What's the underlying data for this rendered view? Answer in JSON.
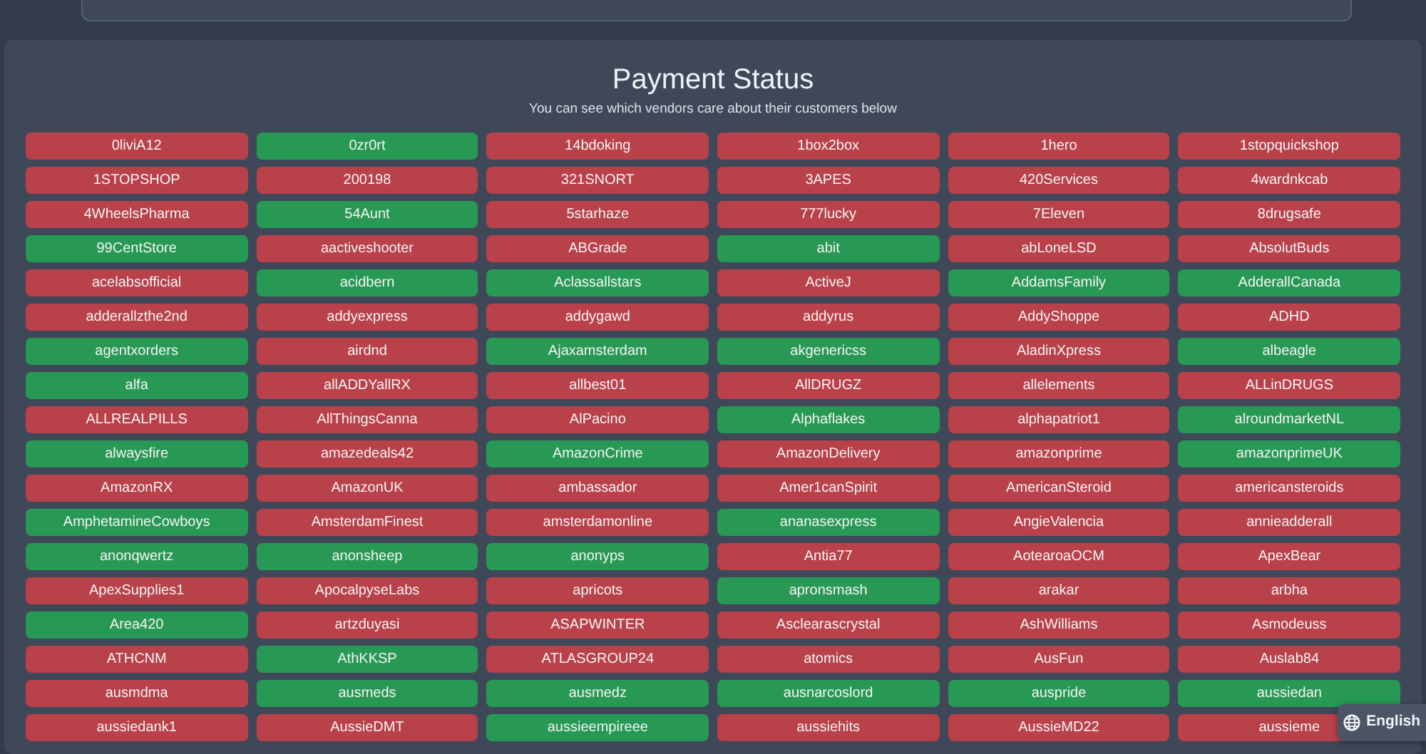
{
  "title": "Payment Status",
  "subtitle": "You can see which vendors care about their customers below",
  "vendors": [
    {
      "name": "0liviA12",
      "ok": false
    },
    {
      "name": "0zr0rt",
      "ok": true
    },
    {
      "name": "14bdoking",
      "ok": false
    },
    {
      "name": "1box2box",
      "ok": false
    },
    {
      "name": "1hero",
      "ok": false
    },
    {
      "name": "1stopquickshop",
      "ok": false
    },
    {
      "name": "1STOPSHOP",
      "ok": false
    },
    {
      "name": "200198",
      "ok": false
    },
    {
      "name": "321SNORT",
      "ok": false
    },
    {
      "name": "3APES",
      "ok": false
    },
    {
      "name": "420Services",
      "ok": false
    },
    {
      "name": "4wardnkcab",
      "ok": false
    },
    {
      "name": "4WheelsPharma",
      "ok": false
    },
    {
      "name": "54Aunt",
      "ok": true
    },
    {
      "name": "5starhaze",
      "ok": false
    },
    {
      "name": "777lucky",
      "ok": false
    },
    {
      "name": "7Eleven",
      "ok": false
    },
    {
      "name": "8drugsafe",
      "ok": false
    },
    {
      "name": "99CentStore",
      "ok": true
    },
    {
      "name": "aactiveshooter",
      "ok": false
    },
    {
      "name": "ABGrade",
      "ok": false
    },
    {
      "name": "abit",
      "ok": true
    },
    {
      "name": "abLoneLSD",
      "ok": false
    },
    {
      "name": "AbsolutBuds",
      "ok": false
    },
    {
      "name": "acelabsofficial",
      "ok": false
    },
    {
      "name": "acidbern",
      "ok": true
    },
    {
      "name": "Aclassallstars",
      "ok": true
    },
    {
      "name": "ActiveJ",
      "ok": false
    },
    {
      "name": "AddamsFamily",
      "ok": true
    },
    {
      "name": "AdderallCanada",
      "ok": true
    },
    {
      "name": "adderallzthe2nd",
      "ok": false
    },
    {
      "name": "addyexpress",
      "ok": false
    },
    {
      "name": "addygawd",
      "ok": false
    },
    {
      "name": "addyrus",
      "ok": false
    },
    {
      "name": "AddyShoppe",
      "ok": false
    },
    {
      "name": "ADHD",
      "ok": false
    },
    {
      "name": "agentxorders",
      "ok": true
    },
    {
      "name": "airdnd",
      "ok": false
    },
    {
      "name": "Ajaxamsterdam",
      "ok": true
    },
    {
      "name": "akgenericss",
      "ok": true
    },
    {
      "name": "AladinXpress",
      "ok": false
    },
    {
      "name": "albeagle",
      "ok": true
    },
    {
      "name": "alfa",
      "ok": true
    },
    {
      "name": "allADDYallRX",
      "ok": false
    },
    {
      "name": "allbest01",
      "ok": false
    },
    {
      "name": "AllDRUGZ",
      "ok": false
    },
    {
      "name": "allelements",
      "ok": false
    },
    {
      "name": "ALLinDRUGS",
      "ok": false
    },
    {
      "name": "ALLREALPILLS",
      "ok": false
    },
    {
      "name": "AllThingsCanna",
      "ok": false
    },
    {
      "name": "AlPacino",
      "ok": false
    },
    {
      "name": "Alphaflakes",
      "ok": true
    },
    {
      "name": "alphapatriot1",
      "ok": false
    },
    {
      "name": "alroundmarketNL",
      "ok": true
    },
    {
      "name": "alwaysfire",
      "ok": true
    },
    {
      "name": "amazedeals42",
      "ok": false
    },
    {
      "name": "AmazonCrime",
      "ok": true
    },
    {
      "name": "AmazonDelivery",
      "ok": false
    },
    {
      "name": "amazonprime",
      "ok": false
    },
    {
      "name": "amazonprimeUK",
      "ok": true
    },
    {
      "name": "AmazonRX",
      "ok": false
    },
    {
      "name": "AmazonUK",
      "ok": false
    },
    {
      "name": "ambassador",
      "ok": false
    },
    {
      "name": "Amer1canSpirit",
      "ok": false
    },
    {
      "name": "AmericanSteroid",
      "ok": false
    },
    {
      "name": "americansteroids",
      "ok": false
    },
    {
      "name": "AmphetamineCowboys",
      "ok": true
    },
    {
      "name": "AmsterdamFinest",
      "ok": false
    },
    {
      "name": "amsterdamonline",
      "ok": false
    },
    {
      "name": "ananasexpress",
      "ok": true
    },
    {
      "name": "AngieValencia",
      "ok": false
    },
    {
      "name": "annieadderall",
      "ok": false
    },
    {
      "name": "anonqwertz",
      "ok": true
    },
    {
      "name": "anonsheep",
      "ok": true
    },
    {
      "name": "anonyps",
      "ok": true
    },
    {
      "name": "Antia77",
      "ok": false
    },
    {
      "name": "AotearoaOCM",
      "ok": false
    },
    {
      "name": "ApexBear",
      "ok": false
    },
    {
      "name": "ApexSupplies1",
      "ok": false
    },
    {
      "name": "ApocalpyseLabs",
      "ok": false
    },
    {
      "name": "apricots",
      "ok": false
    },
    {
      "name": "apronsmash",
      "ok": true
    },
    {
      "name": "arakar",
      "ok": false
    },
    {
      "name": "arbha",
      "ok": false
    },
    {
      "name": "Area420",
      "ok": true
    },
    {
      "name": "artzduyasi",
      "ok": false
    },
    {
      "name": "ASAPWINTER",
      "ok": false
    },
    {
      "name": "Asclearascrystal",
      "ok": false
    },
    {
      "name": "AshWilliams",
      "ok": false
    },
    {
      "name": "Asmodeuss",
      "ok": false
    },
    {
      "name": "ATHCNM",
      "ok": false
    },
    {
      "name": "AthKKSP",
      "ok": true
    },
    {
      "name": "ATLASGROUP24",
      "ok": false
    },
    {
      "name": "atomics",
      "ok": false
    },
    {
      "name": "AusFun",
      "ok": false
    },
    {
      "name": "Auslab84",
      "ok": false
    },
    {
      "name": "ausmdma",
      "ok": false
    },
    {
      "name": "ausmeds",
      "ok": true
    },
    {
      "name": "ausmedz",
      "ok": true
    },
    {
      "name": "ausnarcoslord",
      "ok": true
    },
    {
      "name": "auspride",
      "ok": true
    },
    {
      "name": "aussiedan",
      "ok": true
    },
    {
      "name": "aussiedank1",
      "ok": false
    },
    {
      "name": "AussieDMT",
      "ok": false
    },
    {
      "name": "aussieempireee",
      "ok": true
    },
    {
      "name": "aussiehits",
      "ok": false
    },
    {
      "name": "AussieMD22",
      "ok": false
    },
    {
      "name": "aussieme",
      "ok": false
    }
  ],
  "language_button": "English"
}
